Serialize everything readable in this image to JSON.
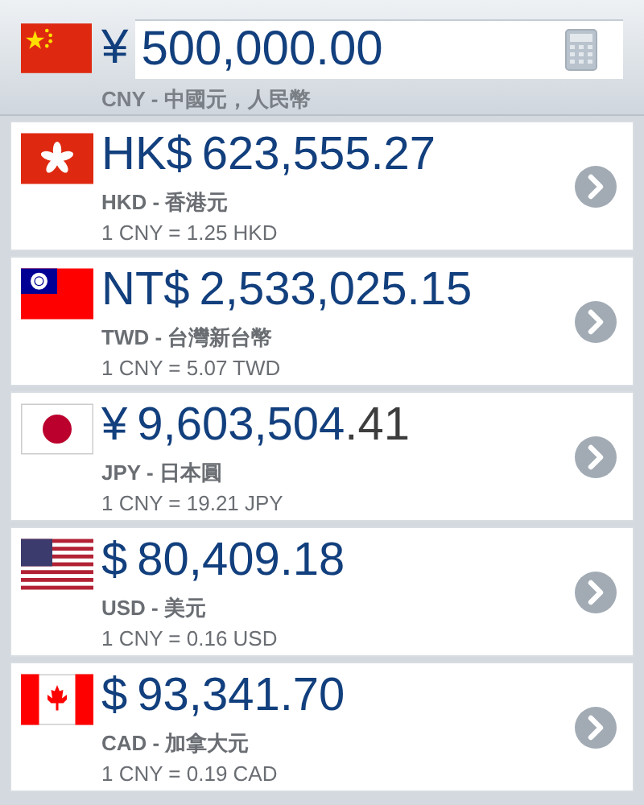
{
  "base": {
    "symbol": "¥",
    "value": "500,000.00",
    "label": "CNY - 中國元，人民幣"
  },
  "rows": [
    {
      "symbol": "HK$",
      "amount": "623,555.27",
      "minor": "",
      "name": "HKD - 香港元",
      "rate": "1 CNY = 1.25 HKD"
    },
    {
      "symbol": "NT$",
      "amount": "2,533,025.15",
      "minor": "",
      "name": "TWD - 台灣新台幣",
      "rate": "1 CNY = 5.07 TWD"
    },
    {
      "symbol": "¥",
      "amount": "9,603,504",
      "minor": ".41",
      "name": "JPY - 日本圓",
      "rate": "1 CNY = 19.21 JPY"
    },
    {
      "symbol": "$",
      "amount": "80,409.18",
      "minor": "",
      "name": "USD - 美元",
      "rate": "1 CNY = 0.16 USD"
    },
    {
      "symbol": "$",
      "amount": "93,341.70",
      "minor": "",
      "name": "CAD - 加拿大元",
      "rate": "1 CNY = 0.19 CAD"
    }
  ]
}
